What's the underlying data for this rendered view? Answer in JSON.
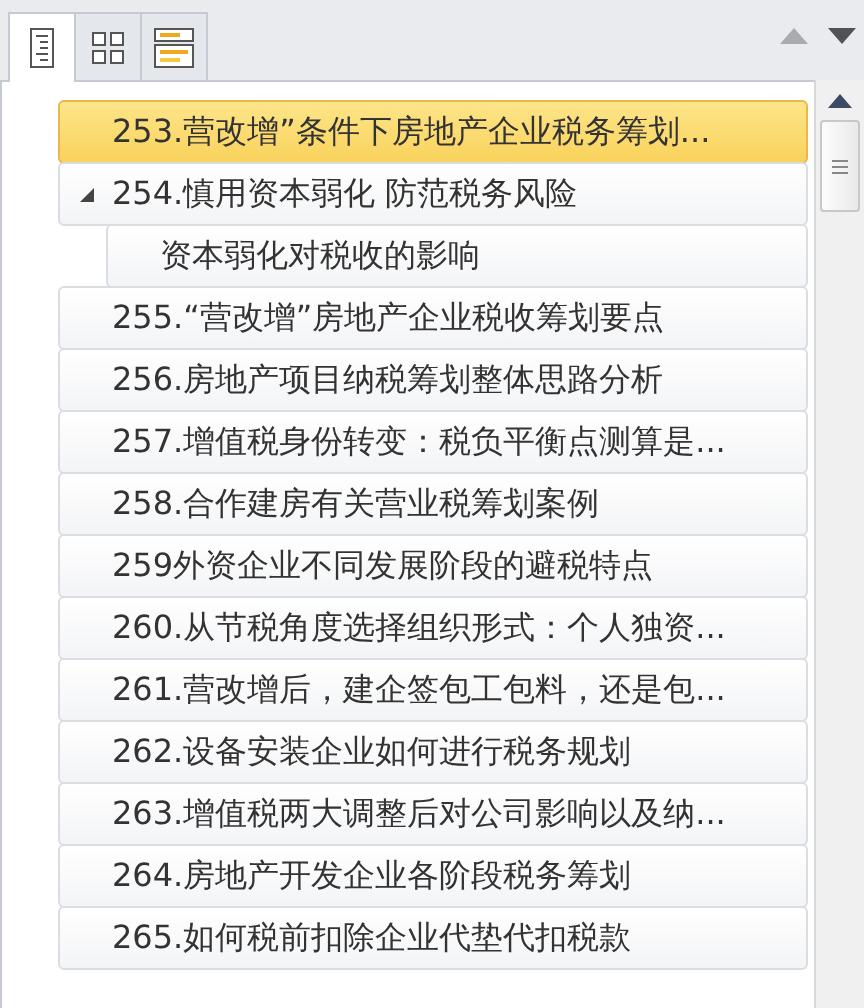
{
  "tabs": [
    {
      "kind": "outline",
      "selected": true
    },
    {
      "kind": "thumbnails",
      "selected": false
    },
    {
      "kind": "slides",
      "selected": false
    }
  ],
  "nav": {
    "up_disabled": true,
    "down_disabled": false
  },
  "tree": [
    {
      "label": "253.营改增”条件下房地产企业税务筹划...",
      "selected": true
    },
    {
      "label": "254.慎用资本弱化 防范税务风险",
      "selected": false,
      "expanded": true,
      "children": [
        {
          "label": "资本弱化对税收的影响",
          "selected": false
        }
      ]
    },
    {
      "label": "255.“营改增”房地产企业税收筹划要点",
      "selected": false
    },
    {
      "label": "256.房地产项目纳税筹划整体思路分析",
      "selected": false
    },
    {
      "label": "257.增值税身份转变：税负平衡点测算是...",
      "selected": false
    },
    {
      "label": "258.合作建房有关营业税筹划案例",
      "selected": false
    },
    {
      "label": "259外资企业不同发展阶段的避税特点",
      "selected": false
    },
    {
      "label": "260.从节税角度选择组织形式：个人独资...",
      "selected": false
    },
    {
      "label": "261.营改增后，建企签包工包料，还是包...",
      "selected": false
    },
    {
      "label": "262.设备安装企业如何进行税务规划",
      "selected": false
    },
    {
      "label": "263.增值税两大调整后对公司影响以及纳...",
      "selected": false
    },
    {
      "label": "264.房地产开发企业各阶段税务筹划",
      "selected": false
    },
    {
      "label": "265.如何税前扣除企业代垫代扣税款",
      "selected": false
    }
  ]
}
